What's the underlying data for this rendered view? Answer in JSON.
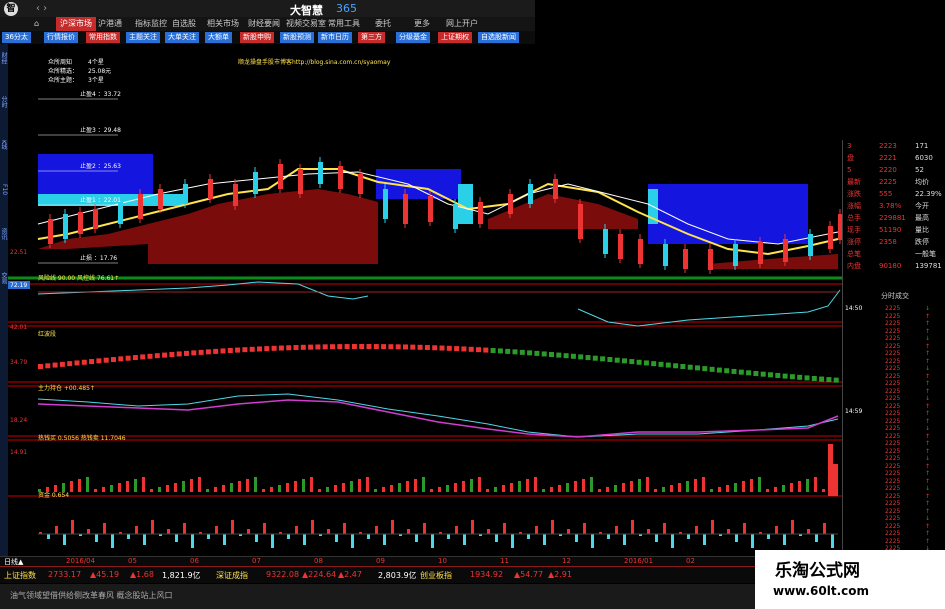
{
  "app": {
    "logo": "智",
    "title": "大智慧",
    "title_num": "365",
    "nav_arrows": "‹ ›"
  },
  "menu": [
    {
      "label": "⌂",
      "active": false
    },
    {
      "label": "沪深市场",
      "active": true
    },
    {
      "label": "沪港通",
      "active": false
    },
    {
      "label": "指标监控",
      "active": false
    },
    {
      "label": "自选股",
      "active": false
    },
    {
      "label": "相关市场",
      "active": false
    },
    {
      "label": "财经要闻",
      "active": false
    },
    {
      "label": "视频交易室",
      "active": false
    },
    {
      "label": "常用工具",
      "active": false
    },
    {
      "label": "委托",
      "active": false
    },
    {
      "label": "更多",
      "active": false
    },
    {
      "label": "网上开户",
      "active": false
    }
  ],
  "toolbar": [
    {
      "label": "36分太",
      "color": "#2a6fd6"
    },
    {
      "label": "行情报价",
      "color": "#2a6fd6"
    },
    {
      "label": "常用指数",
      "color": "#c52b2b"
    },
    {
      "label": "主题关注",
      "color": "#2a6fd6"
    },
    {
      "label": "大单关注",
      "color": "#2a6fd6"
    },
    {
      "label": "大额单",
      "color": "#2a6fd6"
    },
    {
      "label": "新股申购",
      "color": "#c52b2b"
    },
    {
      "label": "新股预测",
      "color": "#2a6fd6"
    },
    {
      "label": "新市日历",
      "color": "#2a6fd6"
    },
    {
      "label": "第三方",
      "color": "#c52b2b"
    },
    {
      "label": "分级基金",
      "color": "#2a6fd6"
    },
    {
      "label": "上证期权",
      "color": "#c52b2b"
    },
    {
      "label": "自选股新闻",
      "color": "#2a6fd6"
    }
  ],
  "rail": [
    "财经",
    "分时",
    "K线",
    "F10",
    "资讯",
    "交易"
  ],
  "main": {
    "info_lines": [
      "众所周知",
      "众所精选：",
      "众所主题："
    ],
    "info_vals": [
      "4个星",
      "25.08元",
      "3个星"
    ],
    "stop_labels": [
      "止盈4 ：33.72",
      "止盈3 ：29.48",
      "止盈2 ：25.63",
      "止盈1 ：22.01",
      "止损 ：17.76"
    ],
    "indicators": [
      "风险线 90.00 风控线 76.61↑",
      "红波段",
      "主力持仓 +00.485↑",
      "热钱买 0.5056 热钱卖 11.7046",
      "资金 0.654"
    ],
    "watermark_line": "顺龙操盘手股市博客http://blog.sina.com.cn/syaomay",
    "axis_left": [
      "22.51",
      "77.19",
      "42.01",
      "34.79",
      "18.24",
      "14.91"
    ],
    "price_badge": "72.19"
  },
  "side": {
    "rows": [
      {
        "a": "3",
        "b": "2223",
        "c": "171"
      },
      {
        "a": "盘",
        "b": "2221",
        "c": "6030"
      },
      {
        "a": "5",
        "b": "2220",
        "c": "52"
      },
      {
        "a": "最新",
        "b": "2225",
        "c": "均价"
      },
      {
        "a": "涨跌",
        "b": "555",
        "c": "22.39%"
      },
      {
        "a": "涨幅",
        "b": "3.78%",
        "c": "今开"
      },
      {
        "a": "总手",
        "b": "229881",
        "c": "最高"
      },
      {
        "a": "现手",
        "b": "51190",
        "c": "量比"
      },
      {
        "a": "涨停",
        "b": "2358",
        "c": "跌停"
      },
      {
        "a": "总笔",
        "b": "",
        "c": "一般笔"
      },
      {
        "a": "内盘",
        "b": "90180",
        "c": "139781"
      }
    ],
    "ticks_header": "分时成交",
    "times": [
      "14:50",
      "14:59"
    ],
    "tick_prices": [
      "2225",
      "2225",
      "2225",
      "2225",
      "2225",
      "2225",
      "2225",
      "2225",
      "2225",
      "2225",
      "2225",
      "2225",
      "2225",
      "2225",
      "2225",
      "2225",
      "2225",
      "2225",
      "2225",
      "2225",
      "2225",
      "2225",
      "2225",
      "2225",
      "2225",
      "2225",
      "2225",
      "2225",
      "2225",
      "2225",
      "2225",
      "2225",
      "2225"
    ]
  },
  "timebar": {
    "labels": [
      "日线▲",
      "2016/04",
      "05",
      "06",
      "07",
      "08",
      "09",
      "10",
      "11",
      "12",
      "2016/01",
      "02"
    ]
  },
  "indexbar": {
    "items": [
      "上证指数",
      "2733.17",
      "▲45.19",
      "▲1.68",
      "1,821.9亿",
      "深证成指",
      "9322.08",
      "▲224.64",
      "▲2.47",
      "2,803.9亿",
      "创业板指",
      "1934.92",
      "▲54.77",
      "▲2.91"
    ]
  },
  "bottom": {
    "ticker": "油气领域望借供给侧改革春风 概念股站上风口"
  },
  "watermark": {
    "name": "乐淘公式网",
    "url": "www.60lt.com"
  }
}
